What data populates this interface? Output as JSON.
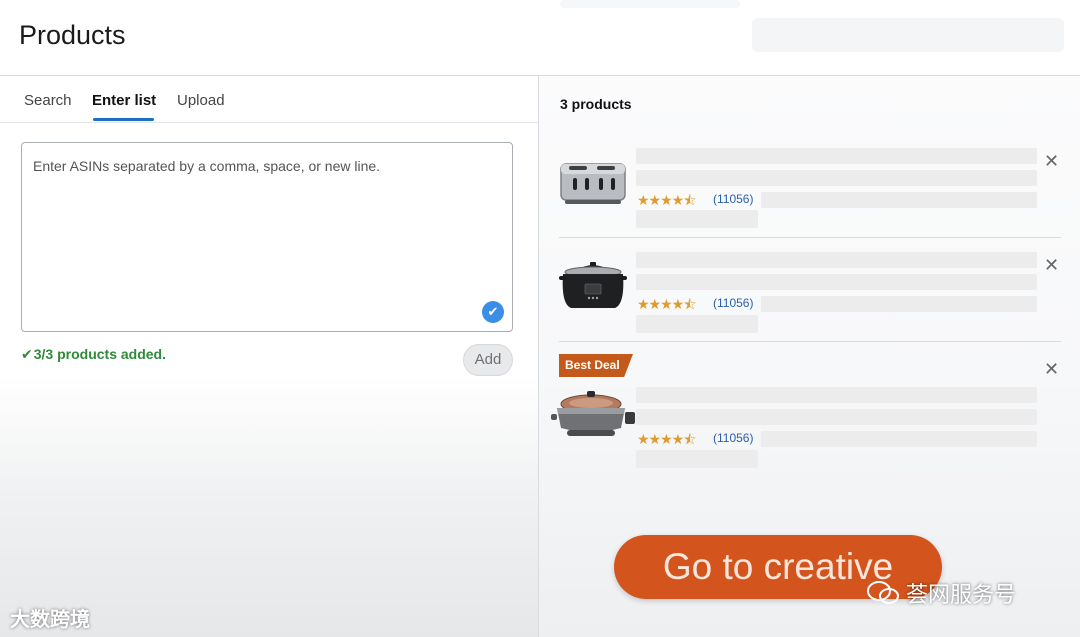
{
  "header": {
    "title": "Products"
  },
  "tabs": [
    {
      "label": "Search"
    },
    {
      "label": "Enter list"
    },
    {
      "label": "Upload"
    }
  ],
  "asin_input": {
    "placeholder": "Enter ASINs separated by a comma, space, or new line.",
    "value": ""
  },
  "status": {
    "check": "✔",
    "message": "3/3 products added."
  },
  "add_button": {
    "label": "Add"
  },
  "product_list": {
    "count_label": "3 products",
    "items": [
      {
        "image_icon": "toaster-image",
        "rating": 4.5,
        "stars": "★★★★⯪",
        "reviews": "(11056)",
        "badge": ""
      },
      {
        "image_icon": "slow-cooker-image",
        "rating": 4.5,
        "stars": "★★★★⯪",
        "reviews": "(11056)",
        "badge": ""
      },
      {
        "image_icon": "electric-skillet-image",
        "rating": 4.5,
        "stars": "★★★★⯪",
        "reviews": "(11056)",
        "badge": "Best Deal"
      }
    ],
    "remove_glyph": "✕"
  },
  "cta": {
    "label": "Go to creative"
  },
  "watermarks": {
    "left": "大数跨境",
    "right": "荟网服务号"
  },
  "colors": {
    "accent_blue": "#1f6fc1",
    "cta_orange": "#d4541e",
    "success_green": "#2e8b3a",
    "star": "#e09a2d"
  }
}
